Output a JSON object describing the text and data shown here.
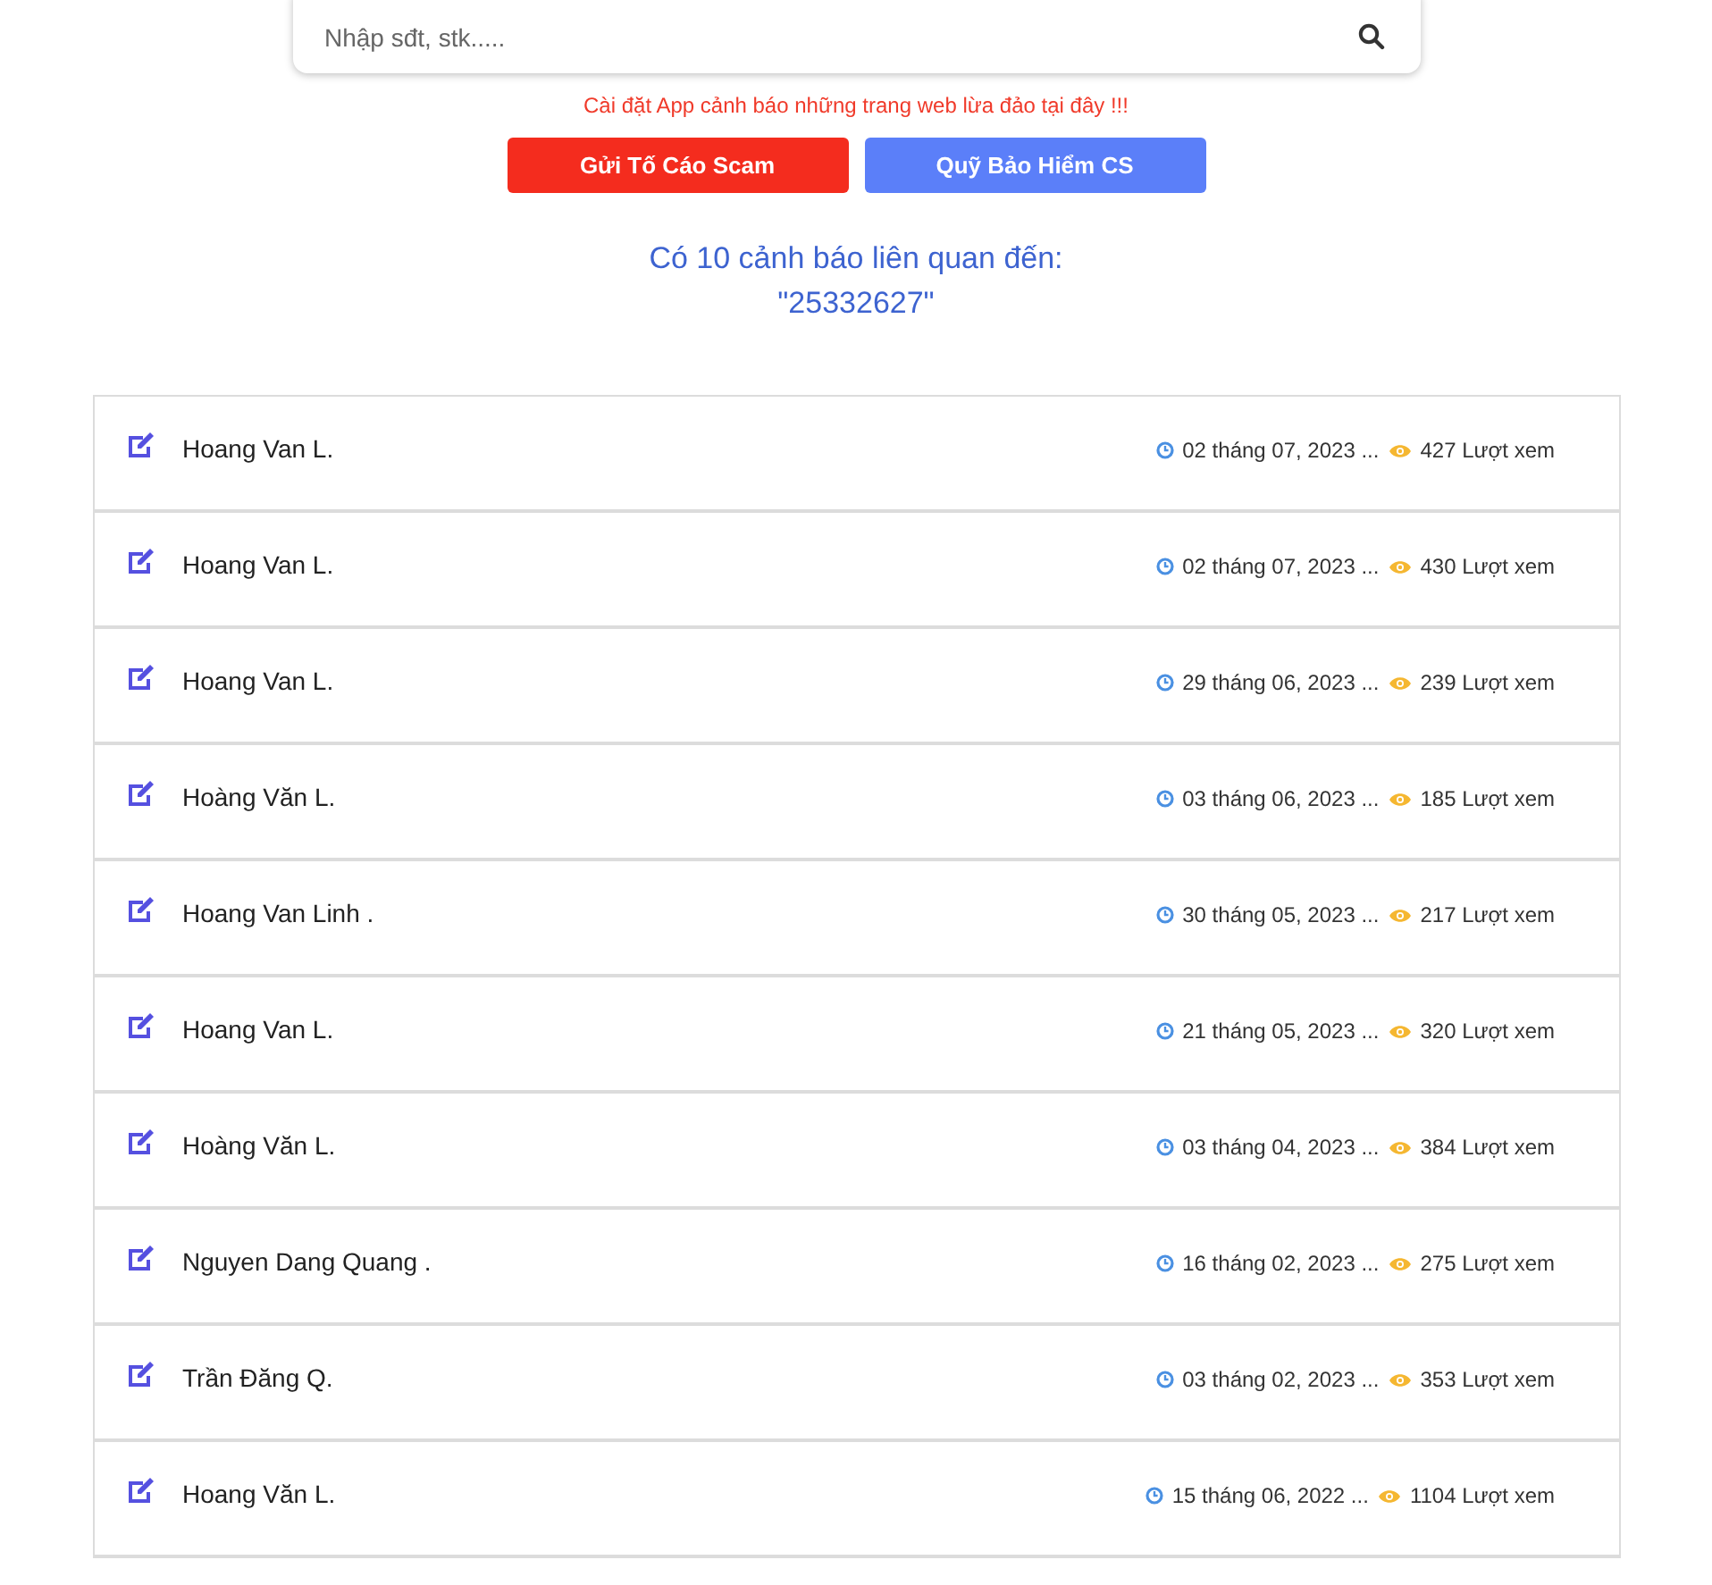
{
  "search": {
    "placeholder": "Nhập sđt, stk....."
  },
  "notice": "Cài đặt App cảnh báo những trang web lừa đảo tại đây !!!",
  "buttons": [
    {
      "label": "Gửi Tố Cáo Scam",
      "kind": "report"
    },
    {
      "label": "Quỹ Bảo Hiểm CS",
      "kind": "fund"
    }
  ],
  "result_heading": "Có 10 cảnh báo liên quan đến:",
  "result_query": "\"25332627\"",
  "reports": [
    {
      "name": "Hoang Van L.",
      "date": "02 tháng 07, 2023 ...",
      "views": "427 Lượt xem"
    },
    {
      "name": "Hoang Van L.",
      "date": "02 tháng 07, 2023 ...",
      "views": "430 Lượt xem"
    },
    {
      "name": "Hoang Van L.",
      "date": "29 tháng 06, 2023 ...",
      "views": "239 Lượt xem"
    },
    {
      "name": "Hoàng Văn L.",
      "date": "03 tháng 06, 2023 ...",
      "views": "185 Lượt xem"
    },
    {
      "name": "Hoang Van Linh .",
      "date": "30 tháng 05, 2023 ...",
      "views": "217 Lượt xem"
    },
    {
      "name": "Hoang Van L.",
      "date": "21 tháng 05, 2023 ...",
      "views": "320 Lượt xem"
    },
    {
      "name": "Hoàng Văn L.",
      "date": "03 tháng 04, 2023 ...",
      "views": "384 Lượt xem"
    },
    {
      "name": "Nguyen Dang Quang .",
      "date": "16 tháng 02, 2023 ...",
      "views": "275 Lượt xem"
    },
    {
      "name": "Trần Đăng Q.",
      "date": "03 tháng 02, 2023 ...",
      "views": "353 Lượt xem"
    },
    {
      "name": "Hoang Văn L.",
      "date": "15 tháng 06, 2022 ...",
      "views": "1104 Lượt xem"
    }
  ]
}
